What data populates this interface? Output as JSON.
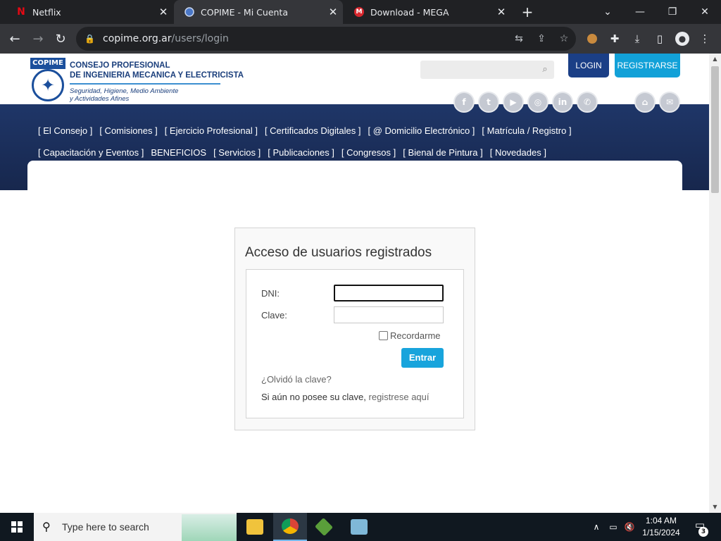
{
  "browser": {
    "tabs": [
      {
        "title": "Netflix",
        "favicon": "N",
        "active": false
      },
      {
        "title": "COPIME - Mi Cuenta",
        "favicon": "globe",
        "active": true
      },
      {
        "title": "Download - MEGA",
        "favicon": "M",
        "active": false
      }
    ],
    "url_host": "copime.org.ar",
    "url_path": "/users/login"
  },
  "header": {
    "logo_badge": "COPIME",
    "logo_line1": "CONSEJO PROFESIONAL",
    "logo_line2": "DE INGENIERIA MECANICA Y ELECTRICISTA",
    "logo_line3": "Seguridad, Higiene, Medio Ambiente",
    "logo_line4": "y Actividades Afines",
    "search_placeholder": "",
    "login_label": "LOGIN",
    "register_label": "REGISTRARSE"
  },
  "social": [
    "facebook",
    "twitter",
    "youtube",
    "instagram",
    "linkedin",
    "whatsapp",
    "home",
    "email"
  ],
  "menu": {
    "row1": [
      "[ El Consejo ]",
      "[ Comisiones ]",
      "[ Ejercicio Profesional ]",
      "[ Certificados Digitales ]",
      "[ @ Domicilio Electrónico ]",
      "[ Matrícula / Registro ]"
    ],
    "row2": [
      "[ Capacitación y Eventos ]",
      "BENEFICIOS",
      "[ Servicios ]",
      "[ Publicaciones ]",
      "[ Congresos ]",
      "[ Bienal de Pintura ]",
      "[ Novedades ]"
    ]
  },
  "login": {
    "title": "Acceso de usuarios registrados",
    "dni_label": "DNI:",
    "dni_value": "",
    "clave_label": "Clave:",
    "clave_value": "",
    "remember_label": "Recordarme",
    "submit_label": "Entrar",
    "forgot_label": "¿Olvidó la clave?",
    "signup_prefix": "Si aún no posee su clave,",
    "signup_link": "registrese aquí"
  },
  "taskbar": {
    "search_placeholder": "Type here to search",
    "time": "1:04 AM",
    "date": "1/15/2024",
    "notification_count": "3"
  },
  "colors": {
    "navy": "#1f3668",
    "login_btn": "#1b3f86",
    "register_btn": "#12a1d8",
    "entrar_btn": "#18a4dc"
  }
}
